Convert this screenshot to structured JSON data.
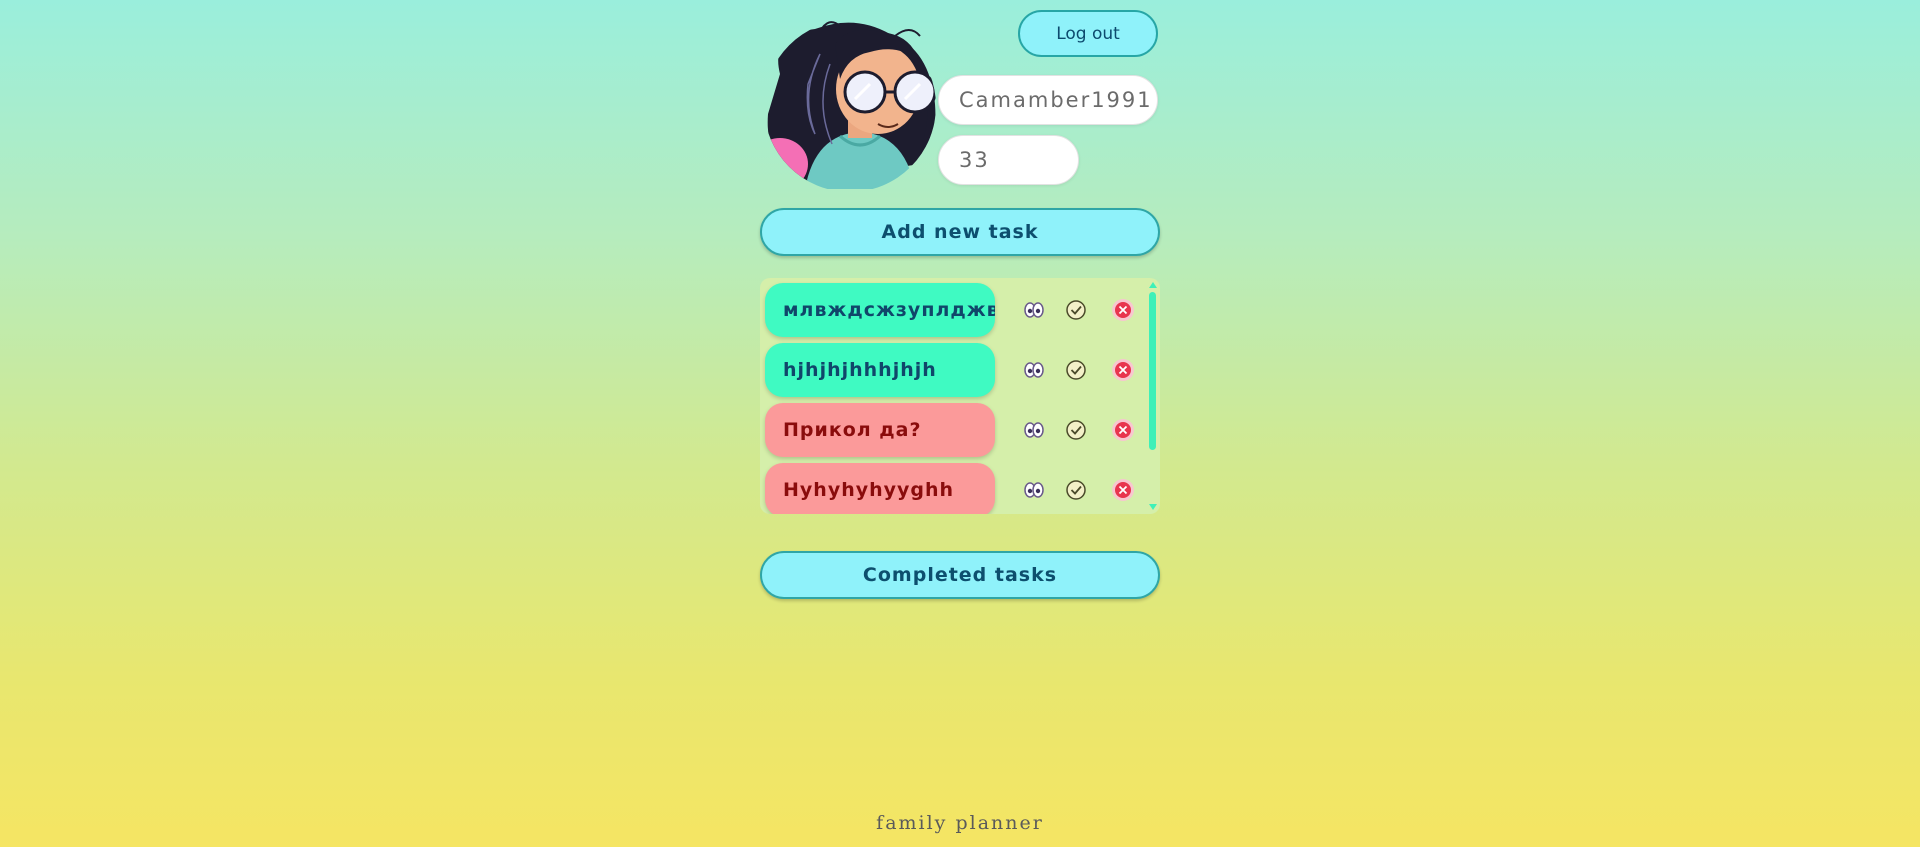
{
  "header": {
    "logout_label": "Log out",
    "username": "Camamber1991",
    "age": "33"
  },
  "actions": {
    "add_task_label": "Add new task",
    "completed_tasks_label": "Completed tasks"
  },
  "tasks": [
    {
      "title": "млвждсжзуплджв",
      "status": "active"
    },
    {
      "title": "hjhjhjhhhjhjh",
      "status": "active"
    },
    {
      "title": "Прикол да?",
      "status": "overdue"
    },
    {
      "title": "Hyhyhyhyyghh",
      "status": "overdue"
    }
  ],
  "icons": {
    "view": "eyes-icon",
    "complete": "checkmark-icon",
    "delete": "delete-icon"
  },
  "colors": {
    "active_task": "#3ffac2",
    "overdue_task": "#fb9a9a",
    "button": "#8ff2fa"
  },
  "footer": {
    "text": "family planner"
  }
}
